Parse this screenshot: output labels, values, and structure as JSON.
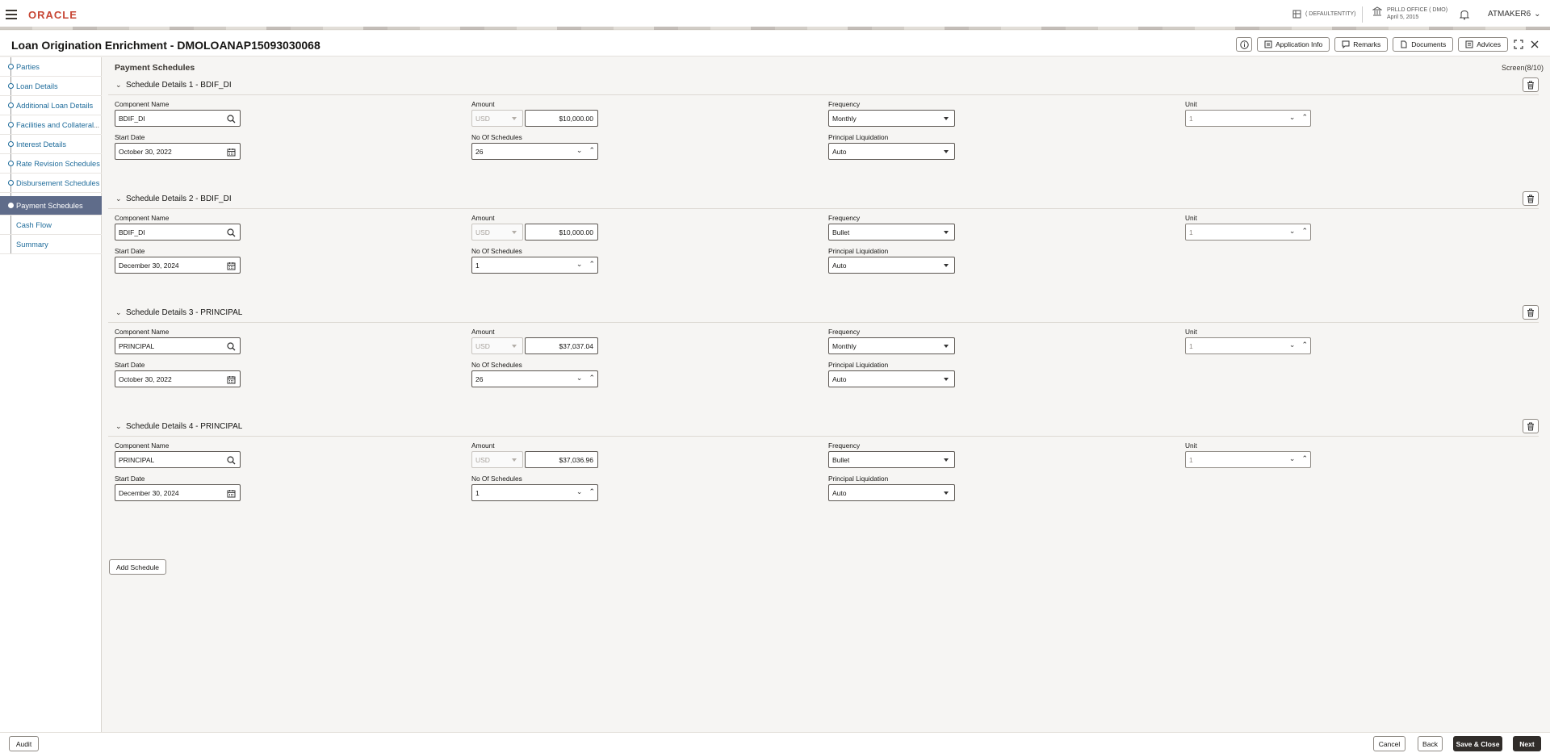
{
  "header": {
    "brand": "ORACLE",
    "entity": "( DEFAULTENTITY)",
    "branch_name": "PRLLD OFFICE ( DMO)",
    "branch_date": "April 5, 2015",
    "user": "ATMAKER6"
  },
  "titlebar": {
    "title": "Loan Origination Enrichment - DMOLOANAP15093030068",
    "buttons": {
      "app_info": "Application Info",
      "remarks": "Remarks",
      "documents": "Documents",
      "advices": "Advices"
    }
  },
  "nav": {
    "items": [
      {
        "label": "Parties"
      },
      {
        "label": "Loan Details"
      },
      {
        "label": "Additional Loan Details"
      },
      {
        "label": "Facilities and Collateral"
      },
      {
        "label": "Interest Details"
      },
      {
        "label": "Rate Revision Schedules"
      },
      {
        "label": "Disbursement Schedules"
      },
      {
        "label": "Payment Schedules"
      },
      {
        "label": "Cash Flow"
      },
      {
        "label": "Summary"
      }
    ],
    "more": "..."
  },
  "main": {
    "page_title": "Payment Schedules",
    "screen": "Screen(8/10)",
    "labels": {
      "component_name": "Component Name",
      "amount": "Amount",
      "frequency": "Frequency",
      "unit": "Unit",
      "start_date": "Start Date",
      "no_of_schedules": "No Of Schedules",
      "principal_liquidation": "Principal Liquidation"
    },
    "sections": [
      {
        "title": "Schedule Details 1 - BDIF_DI",
        "component": "BDIF_DI",
        "currency": "USD",
        "amount": "$10,000.00",
        "frequency": "Monthly",
        "unit": "1",
        "start_date": "October 30, 2022",
        "schedules": "26",
        "liquidation": "Auto"
      },
      {
        "title": "Schedule Details 2 - BDIF_DI",
        "component": "BDIF_DI",
        "currency": "USD",
        "amount": "$10,000.00",
        "frequency": "Bullet",
        "unit": "1",
        "start_date": "December 30, 2024",
        "schedules": "1",
        "liquidation": "Auto"
      },
      {
        "title": "Schedule Details 3 - PRINCIPAL",
        "component": "PRINCIPAL",
        "currency": "USD",
        "amount": "$37,037.04",
        "frequency": "Monthly",
        "unit": "1",
        "start_date": "October 30, 2022",
        "schedules": "26",
        "liquidation": "Auto"
      },
      {
        "title": "Schedule Details 4 - PRINCIPAL",
        "component": "PRINCIPAL",
        "currency": "USD",
        "amount": "$37,036.96",
        "frequency": "Bullet",
        "unit": "1",
        "start_date": "December 30, 2024",
        "schedules": "1",
        "liquidation": "Auto"
      }
    ],
    "add_schedule": "Add Schedule"
  },
  "footer": {
    "audit": "Audit",
    "cancel": "Cancel",
    "back": "Back",
    "save_close": "Save & Close",
    "next": "Next"
  },
  "icons": {
    "menu": "hamburger-icon",
    "info": "info-icon",
    "bell": "bell-icon",
    "search": "search-icon",
    "calendar": "calendar-icon",
    "trash": "trash-icon"
  },
  "colors": {
    "brand": "#c74634",
    "nav_active": "#5f6c8a",
    "link": "#1f6c9b",
    "primary_button": "#312d2a"
  }
}
